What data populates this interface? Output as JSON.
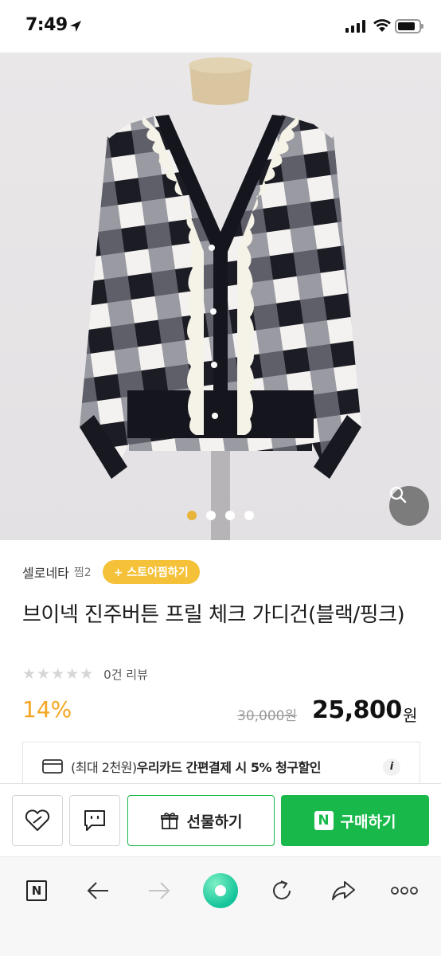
{
  "status_bar": {
    "time": "7:49",
    "icons": [
      "location-arrow-icon",
      "signal-bars-icon",
      "wifi-icon",
      "battery-icon"
    ]
  },
  "gallery": {
    "image_description_icon": "product-photo",
    "page_count": 4,
    "active_page": 1,
    "zoom_icon": "magnifier-icon"
  },
  "store": {
    "name": "셀로네타",
    "wishes": "찜2",
    "follow_label": "+ 스토어찜하기"
  },
  "product": {
    "title": "브이넥 진주버튼 프릴 체크 가디건(블랙/핑크)",
    "rating_stars": 0,
    "review_label": "0건 리뷰",
    "discount": "14%",
    "original_price": "30,000원",
    "sale_price": "25,800",
    "currency": "원"
  },
  "benefit": {
    "prefix": "(최대 2천원)",
    "highlight": "우리카드 간편결제 시 5% 청구할인",
    "info_label": "i"
  },
  "actions": {
    "gift_label": "선물하기",
    "buy_badge": "N",
    "buy_label": "구매하기"
  },
  "browser_nav": {
    "home_letter": "N"
  },
  "colors": {
    "accent_yellow": "#f4c138",
    "discount_orange": "#f5a623",
    "naver_green": "#18b94a",
    "page_dot_active": "#e8b43a"
  }
}
